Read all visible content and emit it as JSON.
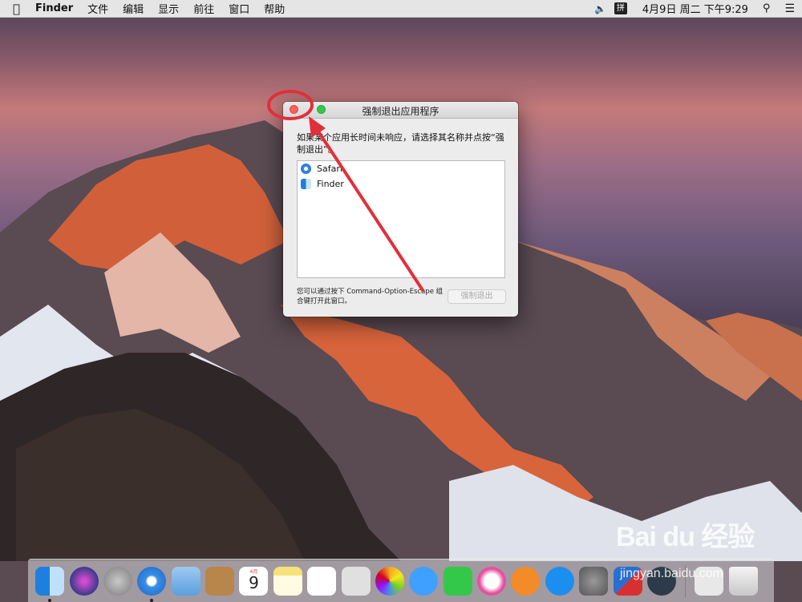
{
  "menubar": {
    "app_name": "Finder",
    "items": [
      "文件",
      "编辑",
      "显示",
      "前往",
      "窗口",
      "帮助"
    ],
    "input_method": "拼",
    "clock": "4月9日 周二 下午9:29"
  },
  "dialog": {
    "title": "强制退出应用程序",
    "instruction": "如果某个应用长时间未响应，请选择其名称并点按“强制退出”。",
    "apps": [
      {
        "name": "Safari",
        "icon": "safari-icon"
      },
      {
        "name": "Finder",
        "icon": "finder-icon"
      }
    ],
    "hint": "您可以通过按下 Command-Option-Escape 组合键打开此窗口。",
    "force_quit_label": "强制退出"
  },
  "dock": {
    "calendar_day": "9",
    "calendar_month": "4月",
    "colors": {
      "finder": "#3a8ee6",
      "siri": "#3a3a8a",
      "launchpad": "#8a8a8a",
      "safari": "#1b66c9",
      "mail": "#5aa0e0",
      "contacts": "#b8864a",
      "notes": "#f6e27a",
      "reminders": "#ffffff",
      "photos_booth": "#e0e0e0",
      "photos": "#ffffff",
      "messages": "#3fa0ff",
      "facetime": "#34c84a",
      "itunes": "#f0f0f0",
      "ibooks": "#f28c28",
      "appstore": "#1b8ef0",
      "sysprefs": "#777777"
    }
  },
  "watermark": {
    "brand": "Bai du 经验",
    "url": "jingyan.baidu.com"
  },
  "annotation": {
    "color": "#e0303a"
  }
}
